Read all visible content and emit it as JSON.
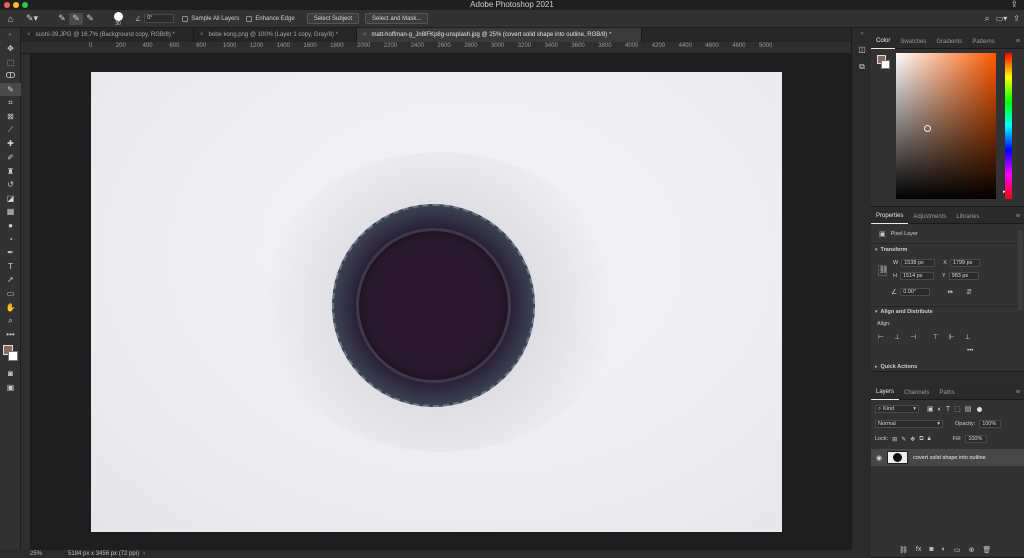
{
  "app_title": "Adobe Photoshop 2021",
  "window_buttons": {
    "close": "#fe5f57",
    "minimize": "#febc2e",
    "maximize": "#28c840"
  },
  "options_bar": {
    "brush_size": "30",
    "angle": "0°",
    "sample_all_layers": "Sample All Layers",
    "enhance_edge": "Enhance Edge",
    "select_subject": "Select Subject",
    "select_and_mask": "Select and Mask..."
  },
  "tabs": [
    {
      "label": "sushi-39.JPG @ 16.7% (Background copy, RGB/8) *"
    },
    {
      "label": "bebe kong.png @ 100% (Layer 1 copy, Gray/8) *"
    },
    {
      "label": "matt-hoffman-g_Jn8lFKp8g-unsplash.jpg @ 25% (covert solid shape into outline, RGB/8) *"
    }
  ],
  "ruler_ticks": [
    "0",
    "200",
    "400",
    "600",
    "800",
    "1000",
    "1200",
    "1400",
    "1600",
    "1800",
    "2000",
    "2200",
    "2400",
    "2600",
    "2800",
    "3000",
    "3200",
    "3400",
    "3600",
    "3800",
    "4000",
    "4200",
    "4400",
    "4600",
    "4800",
    "5000"
  ],
  "color_panel": {
    "tabs": [
      "Color",
      "Swatches",
      "Gradients",
      "Patterns"
    ],
    "foreground": "#8b6a5d",
    "background": "#ffffff",
    "hue_color": "#ff5a00"
  },
  "properties_panel": {
    "tabs": [
      "Properties",
      "Adjustments",
      "Libraries"
    ],
    "layer_type": "Pixel Layer",
    "transform_title": "Transform",
    "w_label": "W",
    "w": "1538 px",
    "h_label": "H",
    "h": "1514 px",
    "x_label": "X",
    "x": "1799 px",
    "y_label": "Y",
    "y": "983 px",
    "angle": "0.00°",
    "align_title": "Align and Distribute",
    "align_label": "Align:",
    "more": "•••",
    "quick_actions": "Quick Actions"
  },
  "layers_panel": {
    "tabs": [
      "Layers",
      "Channels",
      "Paths"
    ],
    "filter_kind": "Kind",
    "blend_mode": "Normal",
    "opacity_label": "Opacity:",
    "opacity": "100%",
    "lock_label": "Lock:",
    "fill_label": "Fill:",
    "fill": "100%",
    "layer_name": "covert solid shape into outline"
  },
  "status_bar": {
    "zoom": "25%",
    "doc_info": "5184 px x 3456 px (72 ppi)"
  }
}
